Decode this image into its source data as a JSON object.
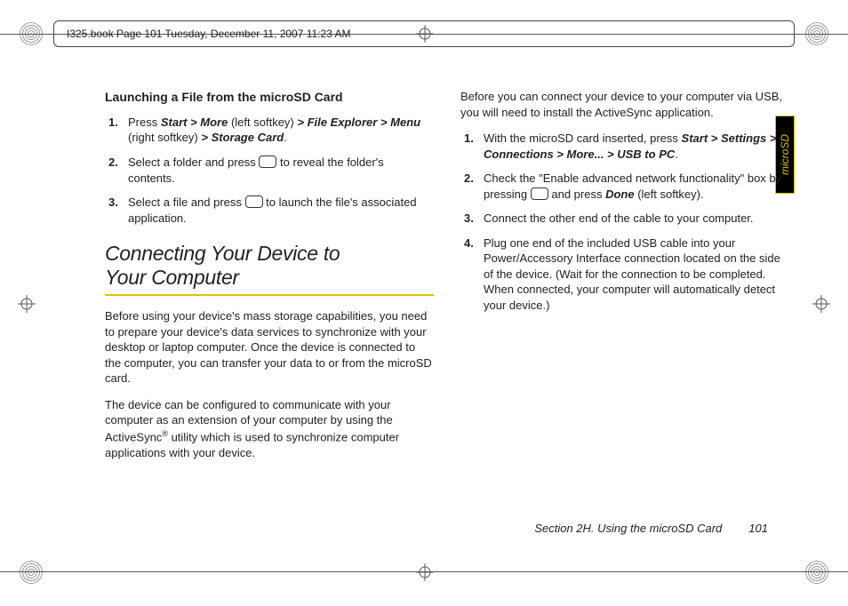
{
  "header_meta": "I325.book  Page 101  Tuesday, December 11, 2007  11:23 AM",
  "side_tab": "microSD",
  "col1": {
    "subhead": "Launching a File from the microSD Card",
    "steps": {
      "s1a": "Press ",
      "s1b": "Start > More",
      "s1c": " (left softkey) ",
      "s1d": "> File Explorer > Menu",
      "s1e": " (right softkey) ",
      "s1f": "> Storage Card",
      "s1g": ".",
      "s2a": "Select a folder and press ",
      "s2b": " to reveal the folder's contents.",
      "s3a": "Select a file and press ",
      "s3b": " to launch the file's associated application."
    },
    "h2a": "Connecting Your Device to",
    "h2b": "Your Computer",
    "p1": "Before using your device's mass storage capabilities, you need to prepare your device's data services to synchronize with your desktop or laptop computer. Once the device is connected to the computer, you can transfer your data to or from the microSD card.",
    "p2a": "The device can be configured to communicate with your computer as an extension of your computer by using the ActiveSync",
    "p2reg": "®",
    "p2b": " utility which is used to synchronize computer applications with your device."
  },
  "col2": {
    "intro": "Before you can connect your device to your computer via USB, you will need to install the ActiveSync application.",
    "steps": {
      "s1a": "With the microSD card inserted, press ",
      "s1b": "Start > Settings > Connections > More... > USB to PC",
      "s1c": ".",
      "s2a": "Check the \"Enable advanced network functionality\" box by pressing ",
      "s2b": " and press ",
      "s2c": "Done",
      "s2d": " (left softkey).",
      "s3": "Connect the other end of the cable to your computer.",
      "s4": "Plug one end of the included USB cable into your Power/Accessory Interface connection located on the side of the device. (Wait for the connection to be completed. When connected, your computer will automatically detect your device.)"
    }
  },
  "footer": {
    "section": "Section 2H. Using the microSD Card",
    "page": "101"
  }
}
